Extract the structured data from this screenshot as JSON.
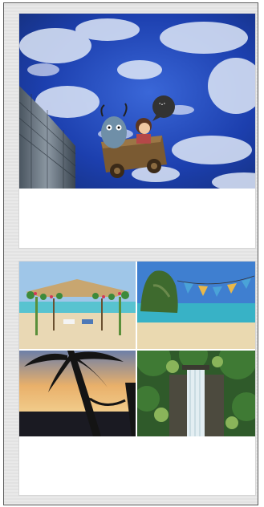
{
  "viewer": {
    "background_color": "#e6e6e6",
    "border_color": "#5a5a5a"
  },
  "posts": [
    {
      "kind": "single-photo",
      "image": "sky-cartoon-cart-photo",
      "caption": ""
    },
    {
      "kind": "photo-grid",
      "images": [
        "beach-gazebo-photo",
        "tropical-island-bunting-photo",
        "palm-hammock-sunset-photo",
        "jungle-waterfall-photo"
      ],
      "caption": ""
    }
  ],
  "colors": {
    "sky_blue": "#1c3fae",
    "cloud_white": "#dfe8f7",
    "sea_turquoise": "#58c3d0",
    "sand": "#e9d8b4",
    "jungle_green": "#2f5a2a"
  }
}
